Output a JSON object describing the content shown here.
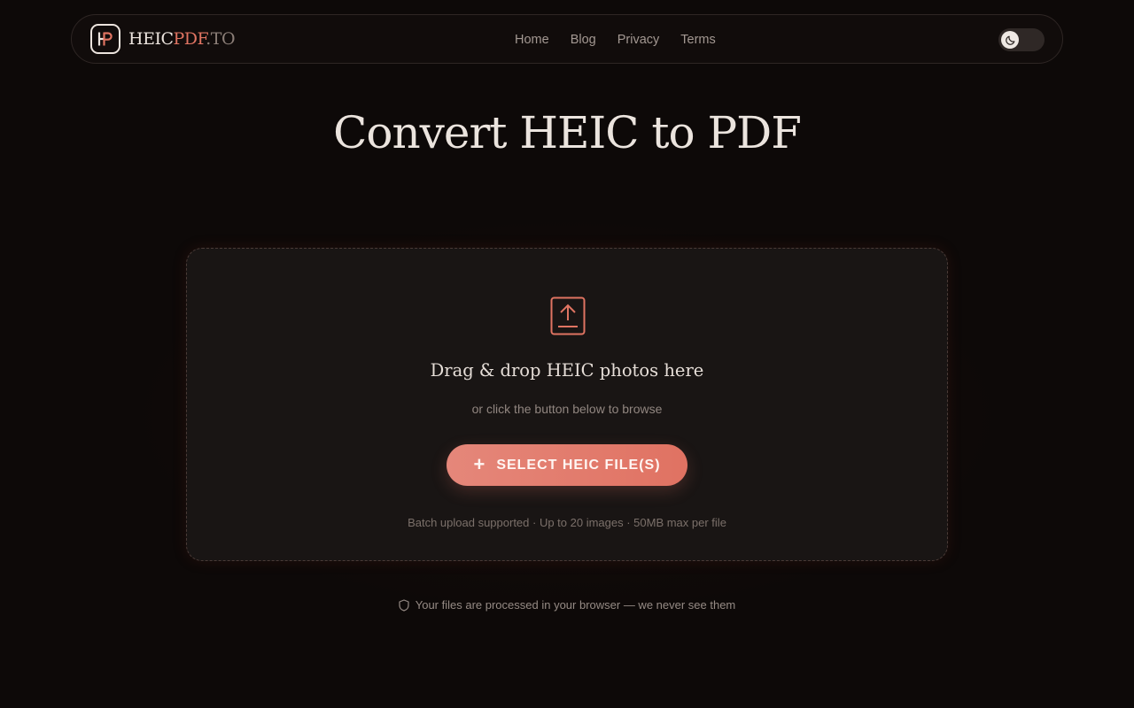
{
  "header": {
    "logo": {
      "text_part1": "HEIC",
      "text_part2": "PDF",
      "text_part3": ".TO",
      "icon": "hp-monogram-icon"
    },
    "nav": [
      {
        "label": "Home"
      },
      {
        "label": "Blog"
      },
      {
        "label": "Privacy"
      },
      {
        "label": "Terms"
      }
    ],
    "theme_toggle": {
      "icon": "moon-icon",
      "state": "dark"
    }
  },
  "main": {
    "title": "Convert HEIC to PDF",
    "dropzone": {
      "icon": "upload-icon",
      "heading": "Drag & drop HEIC photos here",
      "subheading": "or click the button below to browse",
      "button": {
        "icon": "plus-icon",
        "label": "SELECT HEIC FILE(S)"
      },
      "note": "Batch upload supported · Up to 20 images · 50MB max per file"
    },
    "privacy_note": {
      "icon": "shield-icon",
      "text": "Your files are processed in your browser — we never see them"
    }
  },
  "colors": {
    "background": "#0d0908",
    "accent": "#e07462",
    "text": "#ebe4de",
    "muted": "#918680"
  }
}
